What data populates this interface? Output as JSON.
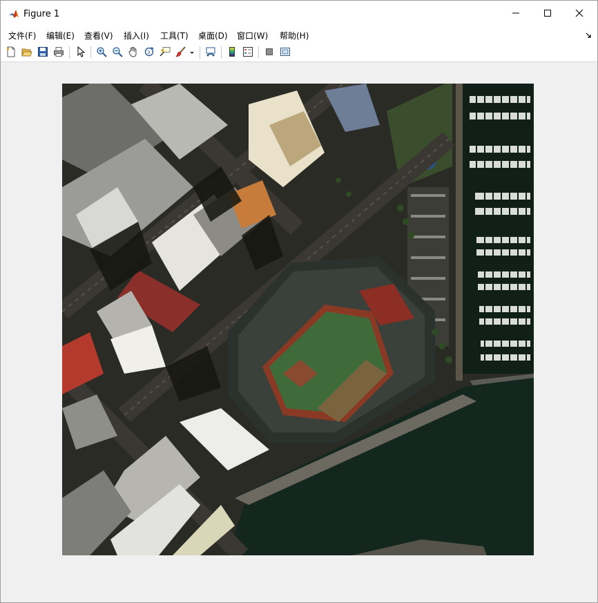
{
  "window": {
    "title": "Figure 1",
    "controls": {
      "minimize": "minimize-icon",
      "maximize": "maximize-icon",
      "close": "close-icon"
    }
  },
  "menu": {
    "items": [
      {
        "label": "文件(F)"
      },
      {
        "label": "编辑(E)"
      },
      {
        "label": "查看(V)"
      },
      {
        "label": "插入(I)"
      },
      {
        "label": "工具(T)"
      },
      {
        "label": "桌面(D)"
      },
      {
        "label": "窗口(W)"
      },
      {
        "label": "帮助(H)"
      }
    ],
    "dock_icon": "dock-arrow-icon"
  },
  "toolbar": {
    "buttons": [
      {
        "icon": "new-figure-icon"
      },
      {
        "icon": "open-file-icon"
      },
      {
        "icon": "save-icon"
      },
      {
        "icon": "print-icon"
      },
      {
        "icon": "edit-plot-arrow-icon"
      },
      {
        "icon": "zoom-in-icon"
      },
      {
        "icon": "zoom-out-icon"
      },
      {
        "icon": "pan-hand-icon"
      },
      {
        "icon": "rotate-3d-icon"
      },
      {
        "icon": "data-cursor-icon"
      },
      {
        "icon": "brush-icon"
      },
      {
        "icon": "brush-dropdown-icon"
      },
      {
        "icon": "link-plot-icon"
      },
      {
        "icon": "insert-colorbar-icon"
      },
      {
        "icon": "insert-legend-icon"
      },
      {
        "icon": "hide-plot-tools-icon"
      },
      {
        "icon": "show-plot-tools-icon"
      }
    ]
  },
  "figure": {
    "content": "aerial-satellite-image",
    "palette": {
      "water": "#14271f",
      "field_grass": "#3f6b3a",
      "infield_dirt": "#8a3a24",
      "stands": "#2b312c",
      "roof_light": "#d8d8d4",
      "road": "#3b3833",
      "shadow": "#15160f"
    }
  }
}
